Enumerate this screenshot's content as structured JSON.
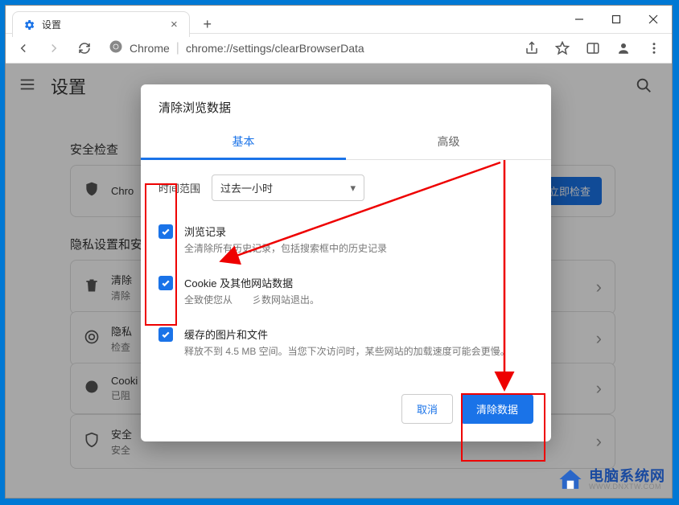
{
  "window": {
    "tab_title": "设置",
    "address_host": "Chrome",
    "address_url": "chrome://settings/clearBrowserData"
  },
  "page": {
    "title": "设置",
    "section_safety": "安全检查",
    "card_safety_text": "Chro",
    "check_now_btn": "立即检查",
    "section_privacy": "隐私设置和安",
    "cards": {
      "clear": {
        "t1": "清除",
        "t2": "清除"
      },
      "privacy": {
        "t1": "隐私",
        "t2": "检查"
      },
      "cookie": {
        "t1": "Cooki",
        "t2": "已阻"
      },
      "security": {
        "t1": "安全",
        "t2": "安全"
      }
    }
  },
  "dialog": {
    "title": "清除浏览数据",
    "tab_basic": "基本",
    "tab_advanced": "高级",
    "time_label": "时间范围",
    "time_value": "过去一小时",
    "items": [
      {
        "h": "浏览记录",
        "d": "全清除所有历史记录，包括搜索框中的历史记录"
      },
      {
        "h": "Cookie 及其他网站数据",
        "d": "全致使您从　　彡数网站退出。"
      },
      {
        "h": "缓存的图片和文件",
        "d": "释放不到 4.5 MB 空间。当您下次访问时，某些网站的加载速度可能会更慢。"
      }
    ],
    "cancel": "取消",
    "confirm": "清除数据"
  },
  "watermark": {
    "big": "电脑系统网",
    "small": "WWW.DNXTW.COM"
  }
}
